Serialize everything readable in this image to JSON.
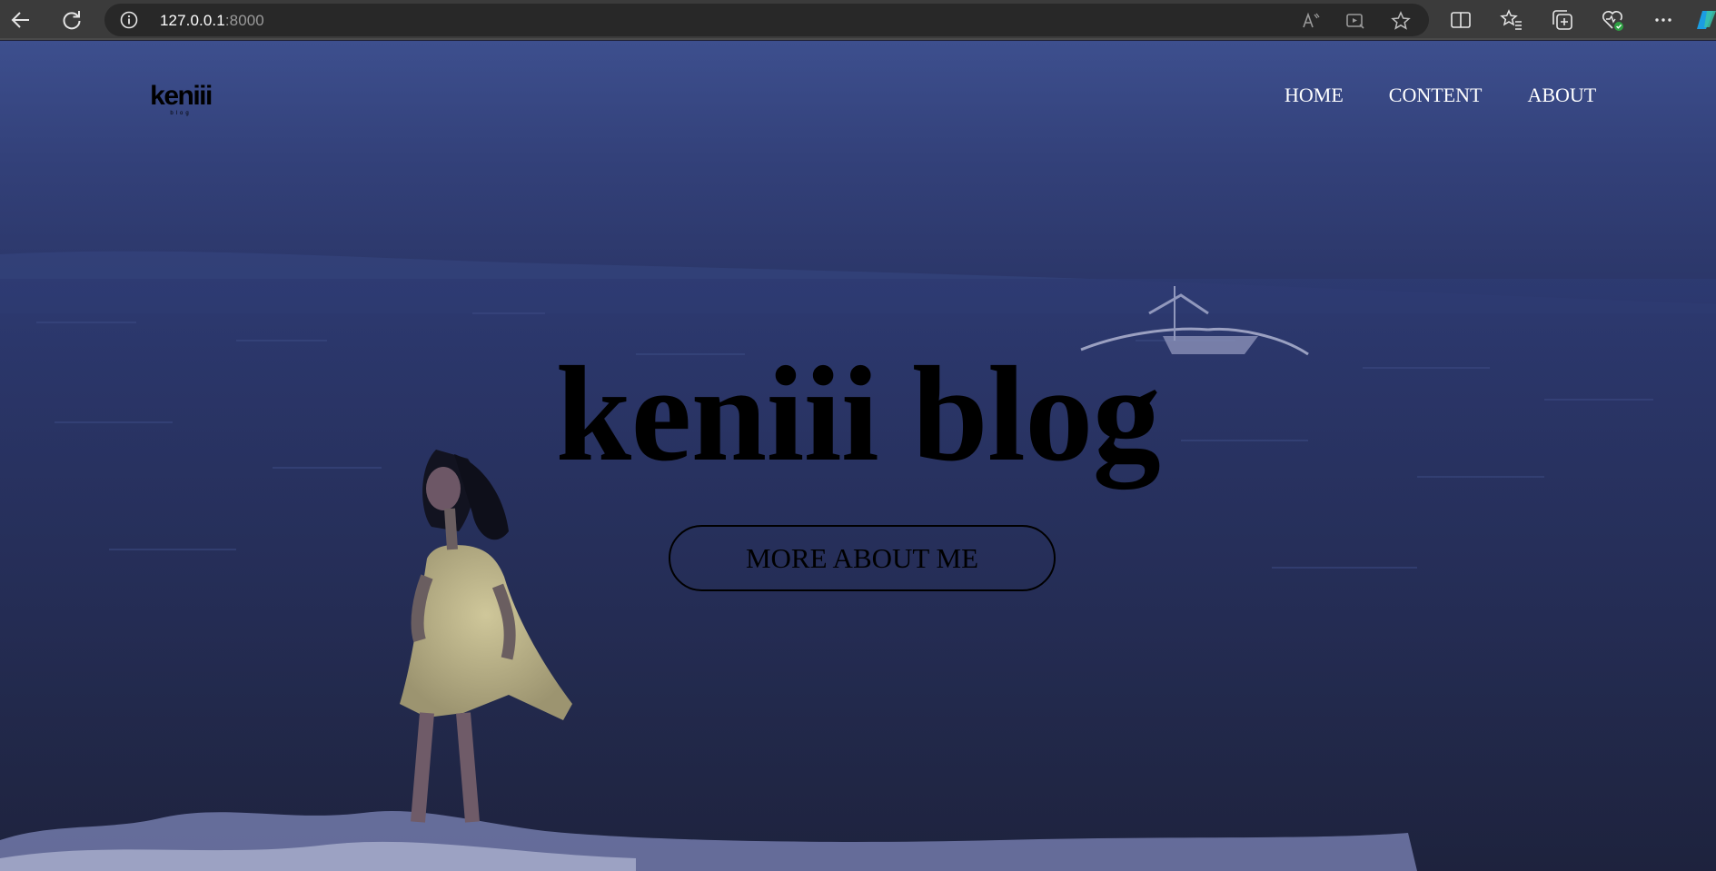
{
  "browser": {
    "url_host": "127.0.0.1",
    "url_port": ":8000",
    "icons": [
      "back-icon",
      "reload-icon",
      "info-icon",
      "read-aloud-icon",
      "media-icon",
      "favorite-star-icon",
      "split-screen-icon",
      "favorites-icon",
      "collections-icon",
      "browser-essentials-icon",
      "more-icon",
      "copilot-icon"
    ]
  },
  "site": {
    "logo_text": "keniii",
    "logo_subtext": "blog",
    "nav": {
      "home": "HOME",
      "content": "CONTENT",
      "about": "ABOUT"
    },
    "hero_title": "keniii blog",
    "cta_label": "MORE ABOUT ME"
  },
  "colors": {
    "browser_chrome": "#3b3b3b",
    "address_bar": "#282828",
    "hero_top": "#3d4f8e",
    "hero_bottom": "#1c1f34",
    "nav_text": "#ffffff",
    "title_text": "#000000"
  }
}
